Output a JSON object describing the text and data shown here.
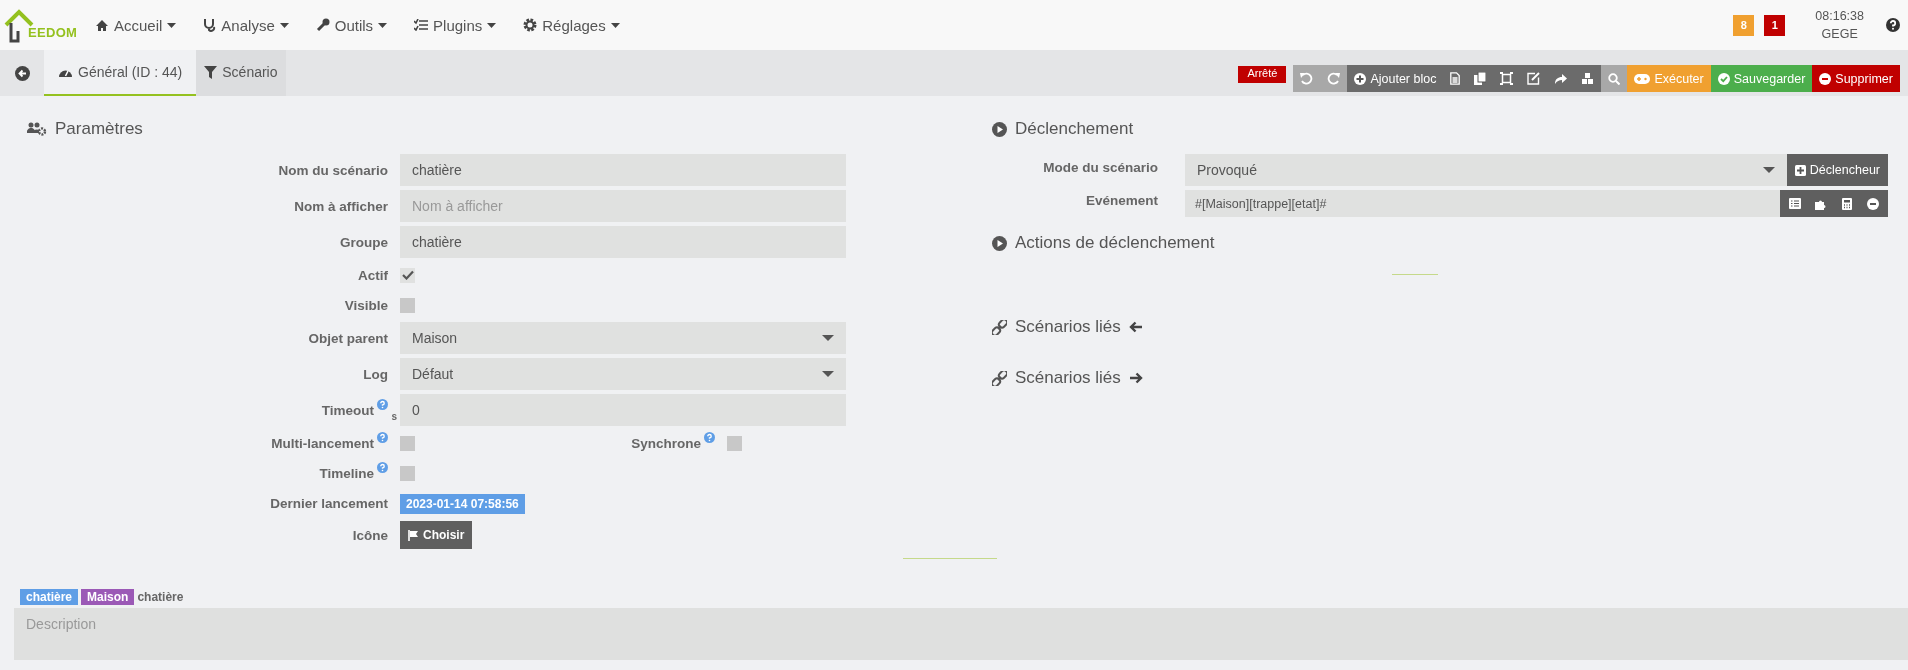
{
  "logo": {
    "text": "EEDOM"
  },
  "nav": [
    {
      "label": "Accueil"
    },
    {
      "label": "Analyse"
    },
    {
      "label": "Outils"
    },
    {
      "label": "Plugins"
    },
    {
      "label": "Réglages"
    }
  ],
  "header": {
    "badges": [
      {
        "label": "8",
        "color": "#f0a030"
      },
      {
        "label": "1",
        "color": "#c00000"
      }
    ],
    "time": "08:16:38",
    "user": "GEGE"
  },
  "tabs": [
    {
      "label": "Général (ID : 44)",
      "selected": true
    },
    {
      "label": "Scénario",
      "selected": false
    }
  ],
  "toolbar": {
    "status": "Arrêté",
    "add_block": "Ajouter bloc",
    "execute": "Exécuter",
    "save": "Sauvegarder",
    "delete": "Supprimer"
  },
  "parametres": {
    "title": "Paramètres",
    "rows": [
      {
        "kind": "text",
        "label": "Nom du scénario",
        "value": "chatière"
      },
      {
        "kind": "text",
        "label": "Nom à afficher",
        "placeholder": "Nom à afficher"
      },
      {
        "kind": "text",
        "label": "Groupe",
        "value": "chatière"
      },
      {
        "kind": "checkbox",
        "label": "Actif",
        "checked": true
      },
      {
        "kind": "checkbox",
        "label": "Visible",
        "checked": false
      },
      {
        "kind": "select",
        "label": "Objet parent",
        "value": "Maison"
      },
      {
        "kind": "select",
        "label": "Log",
        "value": "Défaut"
      },
      {
        "kind": "text",
        "label": "Timeout",
        "help": true,
        "unit": "s",
        "value": "0"
      },
      {
        "kind": "checkbox",
        "label": "Multi-lancement",
        "help": true,
        "checked": false,
        "extra": {
          "label": "Synchrone",
          "help": true,
          "checked": false
        }
      },
      {
        "kind": "checkbox",
        "label": "Timeline",
        "help": true,
        "checked": false
      },
      {
        "kind": "date",
        "label": "Dernier lancement",
        "value": "2023-01-14 07:58:56"
      },
      {
        "kind": "button",
        "label": "Icône",
        "value": "Choisir"
      }
    ]
  },
  "declenchement": {
    "title": "Déclenchement",
    "mode_label": "Mode du scénario",
    "mode": "Provoqué",
    "trigger_button": "Déclencheur",
    "event_label": "Evénement",
    "event": "#[Maison][trappe][etat]#"
  },
  "sections": [
    {
      "title": "Actions de déclenchement",
      "kind": "play"
    },
    {
      "title": "Scénarios liés",
      "kind": "link-left"
    },
    {
      "title": "Scénarios liés",
      "kind": "link-right"
    }
  ],
  "tags": [
    {
      "label": "chatière",
      "color": "#5f9ee6"
    },
    {
      "label": "Maison",
      "color": "#9b59b6"
    }
  ],
  "tag_text": "chatière",
  "description": {
    "placeholder": "Description"
  }
}
